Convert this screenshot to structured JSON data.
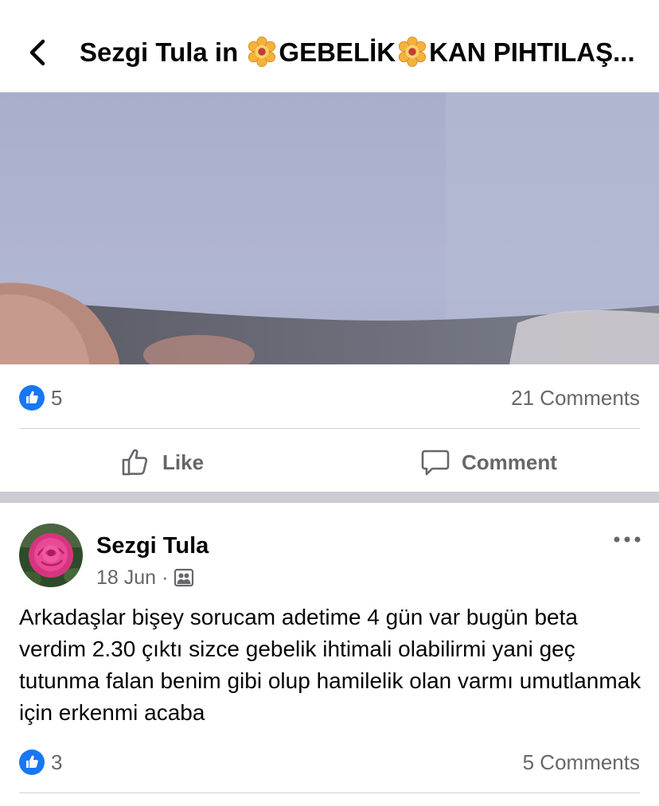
{
  "header": {
    "title_prefix": "Sezgi Tula in ",
    "group_part1": "GEBELİK",
    "group_part2": "KAN PIHTILAŞ..."
  },
  "post1": {
    "reaction_count": "5",
    "comments_label": "21 Comments",
    "like_label": "Like",
    "comment_label": "Comment"
  },
  "post2": {
    "author": "Sezgi Tula",
    "date": "18 Jun",
    "meta_separator": "·",
    "text": "Arkadaşlar bişey sorucam adetime 4 gün var bugün beta verdim 2.30 çıktı sizce gebelik ihtimali olabilirmi yani geç tutunma falan benim gibi olup hamilelik olan varmı umutlanmak için erkenmi acaba",
    "reaction_count": "3",
    "comments_label": "5 Comments"
  },
  "icons": {
    "back": "chevron-left-icon",
    "flower": "flower-emoji-icon",
    "like_badge": "thumbs-up-badge-icon",
    "like_button": "thumbs-up-outline-icon",
    "comment_button": "speech-bubble-icon",
    "audience": "group-members-icon",
    "more": "more-horizontal-icon"
  },
  "colors": {
    "accent_blue": "#1877f2",
    "secondary_text": "#65676b",
    "divider": "#ced0d4",
    "section_band": "#c9ccd1"
  }
}
